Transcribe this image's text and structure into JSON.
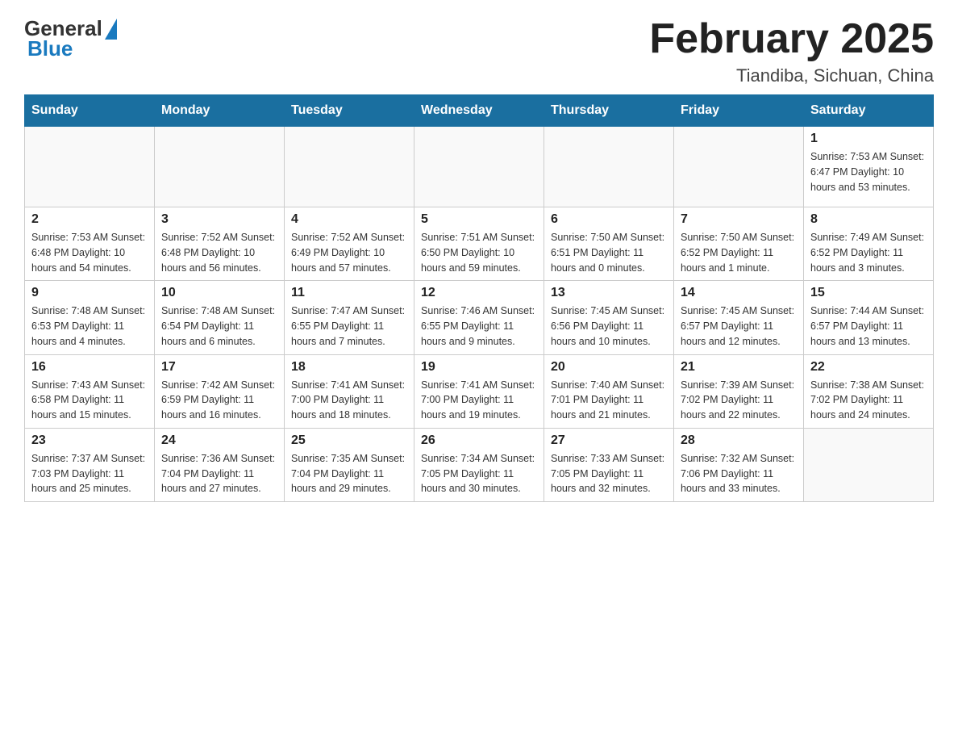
{
  "header": {
    "logo_general": "General",
    "logo_blue": "Blue",
    "title": "February 2025",
    "subtitle": "Tiandiba, Sichuan, China"
  },
  "days_of_week": [
    "Sunday",
    "Monday",
    "Tuesday",
    "Wednesday",
    "Thursday",
    "Friday",
    "Saturday"
  ],
  "weeks": [
    [
      {
        "day": "",
        "info": ""
      },
      {
        "day": "",
        "info": ""
      },
      {
        "day": "",
        "info": ""
      },
      {
        "day": "",
        "info": ""
      },
      {
        "day": "",
        "info": ""
      },
      {
        "day": "",
        "info": ""
      },
      {
        "day": "1",
        "info": "Sunrise: 7:53 AM\nSunset: 6:47 PM\nDaylight: 10 hours\nand 53 minutes."
      }
    ],
    [
      {
        "day": "2",
        "info": "Sunrise: 7:53 AM\nSunset: 6:48 PM\nDaylight: 10 hours\nand 54 minutes."
      },
      {
        "day": "3",
        "info": "Sunrise: 7:52 AM\nSunset: 6:48 PM\nDaylight: 10 hours\nand 56 minutes."
      },
      {
        "day": "4",
        "info": "Sunrise: 7:52 AM\nSunset: 6:49 PM\nDaylight: 10 hours\nand 57 minutes."
      },
      {
        "day": "5",
        "info": "Sunrise: 7:51 AM\nSunset: 6:50 PM\nDaylight: 10 hours\nand 59 minutes."
      },
      {
        "day": "6",
        "info": "Sunrise: 7:50 AM\nSunset: 6:51 PM\nDaylight: 11 hours\nand 0 minutes."
      },
      {
        "day": "7",
        "info": "Sunrise: 7:50 AM\nSunset: 6:52 PM\nDaylight: 11 hours\nand 1 minute."
      },
      {
        "day": "8",
        "info": "Sunrise: 7:49 AM\nSunset: 6:52 PM\nDaylight: 11 hours\nand 3 minutes."
      }
    ],
    [
      {
        "day": "9",
        "info": "Sunrise: 7:48 AM\nSunset: 6:53 PM\nDaylight: 11 hours\nand 4 minutes."
      },
      {
        "day": "10",
        "info": "Sunrise: 7:48 AM\nSunset: 6:54 PM\nDaylight: 11 hours\nand 6 minutes."
      },
      {
        "day": "11",
        "info": "Sunrise: 7:47 AM\nSunset: 6:55 PM\nDaylight: 11 hours\nand 7 minutes."
      },
      {
        "day": "12",
        "info": "Sunrise: 7:46 AM\nSunset: 6:55 PM\nDaylight: 11 hours\nand 9 minutes."
      },
      {
        "day": "13",
        "info": "Sunrise: 7:45 AM\nSunset: 6:56 PM\nDaylight: 11 hours\nand 10 minutes."
      },
      {
        "day": "14",
        "info": "Sunrise: 7:45 AM\nSunset: 6:57 PM\nDaylight: 11 hours\nand 12 minutes."
      },
      {
        "day": "15",
        "info": "Sunrise: 7:44 AM\nSunset: 6:57 PM\nDaylight: 11 hours\nand 13 minutes."
      }
    ],
    [
      {
        "day": "16",
        "info": "Sunrise: 7:43 AM\nSunset: 6:58 PM\nDaylight: 11 hours\nand 15 minutes."
      },
      {
        "day": "17",
        "info": "Sunrise: 7:42 AM\nSunset: 6:59 PM\nDaylight: 11 hours\nand 16 minutes."
      },
      {
        "day": "18",
        "info": "Sunrise: 7:41 AM\nSunset: 7:00 PM\nDaylight: 11 hours\nand 18 minutes."
      },
      {
        "day": "19",
        "info": "Sunrise: 7:41 AM\nSunset: 7:00 PM\nDaylight: 11 hours\nand 19 minutes."
      },
      {
        "day": "20",
        "info": "Sunrise: 7:40 AM\nSunset: 7:01 PM\nDaylight: 11 hours\nand 21 minutes."
      },
      {
        "day": "21",
        "info": "Sunrise: 7:39 AM\nSunset: 7:02 PM\nDaylight: 11 hours\nand 22 minutes."
      },
      {
        "day": "22",
        "info": "Sunrise: 7:38 AM\nSunset: 7:02 PM\nDaylight: 11 hours\nand 24 minutes."
      }
    ],
    [
      {
        "day": "23",
        "info": "Sunrise: 7:37 AM\nSunset: 7:03 PM\nDaylight: 11 hours\nand 25 minutes."
      },
      {
        "day": "24",
        "info": "Sunrise: 7:36 AM\nSunset: 7:04 PM\nDaylight: 11 hours\nand 27 minutes."
      },
      {
        "day": "25",
        "info": "Sunrise: 7:35 AM\nSunset: 7:04 PM\nDaylight: 11 hours\nand 29 minutes."
      },
      {
        "day": "26",
        "info": "Sunrise: 7:34 AM\nSunset: 7:05 PM\nDaylight: 11 hours\nand 30 minutes."
      },
      {
        "day": "27",
        "info": "Sunrise: 7:33 AM\nSunset: 7:05 PM\nDaylight: 11 hours\nand 32 minutes."
      },
      {
        "day": "28",
        "info": "Sunrise: 7:32 AM\nSunset: 7:06 PM\nDaylight: 11 hours\nand 33 minutes."
      },
      {
        "day": "",
        "info": ""
      }
    ]
  ]
}
